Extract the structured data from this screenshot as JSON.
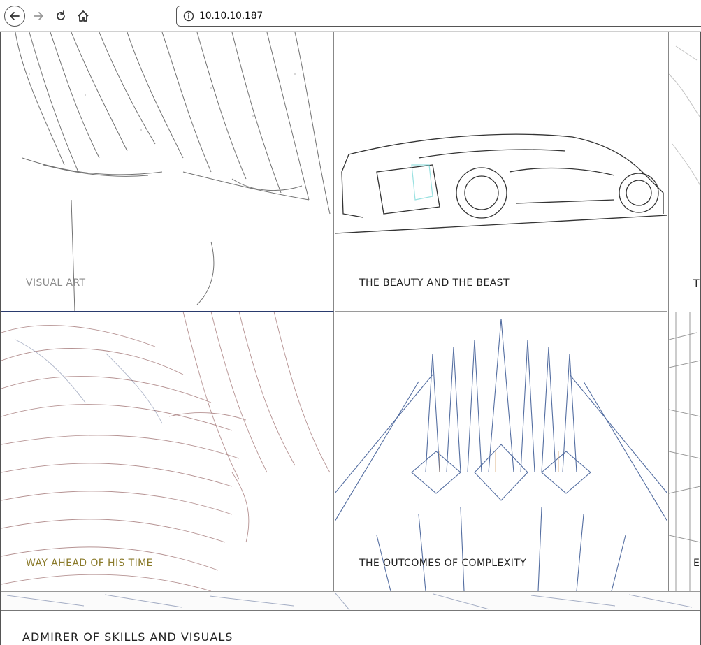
{
  "browser": {
    "url": "10.10.10.187",
    "icons": {
      "back": "back-arrow-icon",
      "forward": "forward-arrow-icon",
      "reload": "reload-icon",
      "home": "home-icon",
      "site_info": "site-info-icon"
    }
  },
  "gallery": {
    "tiles": [
      {
        "caption": "VISUAL ART"
      },
      {
        "caption": "THE BEAUTY AND THE BEAST"
      },
      {
        "caption": "TH"
      },
      {
        "caption": "WAY AHEAD OF HIS TIME"
      },
      {
        "caption": "THE OUTCOMES OF COMPLEXITY"
      },
      {
        "caption": "E"
      }
    ]
  },
  "footer": {
    "title": "ADMIRER OF SKILLS AND VISUALS"
  }
}
